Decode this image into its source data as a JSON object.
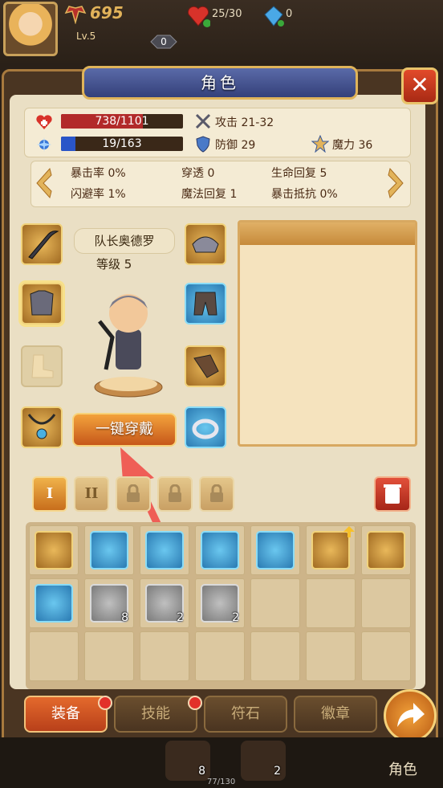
{
  "topbar": {
    "power": "695",
    "level": "Lv.5",
    "hp": "25/30",
    "gems": "0",
    "badge": "0"
  },
  "panel": {
    "title": "角色",
    "close_label": "✕"
  },
  "stats": {
    "hp_bar": {
      "text": "738/1101",
      "fraction": 0.67,
      "color": "#b22a2a"
    },
    "mp_bar": {
      "text": "19/163",
      "fraction": 0.12,
      "color": "#2a55c8"
    },
    "attack": "攻击 21-32",
    "defense": "防御 29",
    "magic": "魔力 36"
  },
  "substats": {
    "row1": [
      "暴击率 0%",
      "穿透 0",
      "生命回复 5"
    ],
    "row2": [
      "闪避率 1%",
      "魔法回复 1",
      "暴击抵抗 0%"
    ]
  },
  "hero": {
    "name": "队长奥德罗",
    "level": "等级 5",
    "equip_all": "一键穿戴"
  },
  "pages": {
    "tab1": "I",
    "tab2": "II"
  },
  "inventory": {
    "counts": [
      "8",
      "2",
      "2"
    ]
  },
  "bottom_tabs": {
    "equip": "装备",
    "skill": "技能",
    "rune": "符石",
    "badge": "徽章"
  },
  "footer": {
    "role": "角色",
    "exp": "77/130",
    "q1": "8",
    "q2": "2"
  }
}
